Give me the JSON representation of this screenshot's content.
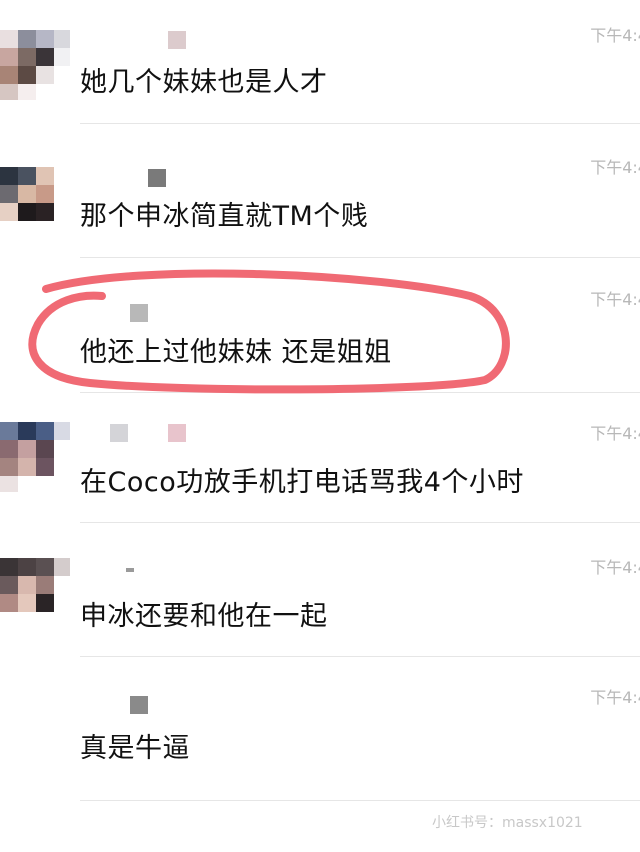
{
  "chat": {
    "messages": [
      {
        "time": "下午4:4",
        "text": "她几个妹妹也是人才"
      },
      {
        "time": "下午4:4",
        "text": "那个申冰简直就TM个贱"
      },
      {
        "time": "下午4:4",
        "text": "他还上过他妹妹 还是姐姐",
        "highlighted": true
      },
      {
        "time": "下午4:4",
        "text": "在Coco功放手机打电话骂我4个小时"
      },
      {
        "time": "下午4:4",
        "text": "申冰还要和他在一起"
      },
      {
        "time": "下午4:4",
        "text": "真是牛逼"
      }
    ]
  },
  "annotation": {
    "circle_color": "#f06a74"
  },
  "watermark": {
    "text": "小红书号：massx1021"
  }
}
